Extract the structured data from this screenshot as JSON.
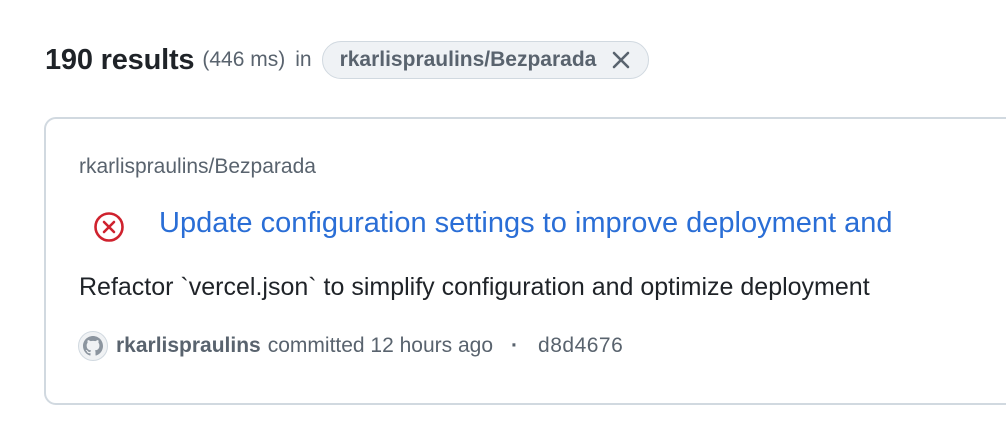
{
  "header": {
    "results_count": "190 results",
    "results_time": "(446 ms)",
    "in_label": "in",
    "repo_filter": "rkarlispraulins/Bezparada"
  },
  "result": {
    "repo_name": "rkarlispraulins/Bezparada",
    "status_icon": "x-circle-icon",
    "status_color": "#cf222e",
    "title": "Update configuration settings to improve deployment and",
    "body": "Refactor `vercel.json` to simplify configuration and optimize deployment",
    "author": "rkarlispraulins",
    "committed_text": "committed 12 hours ago",
    "separator": "·",
    "sha": "d8d4676"
  },
  "colors": {
    "link": "#2a6ed6",
    "muted": "#59636e",
    "text": "#1f2328",
    "border": "#d1d9e0",
    "chip_bg": "#eff2f5"
  }
}
